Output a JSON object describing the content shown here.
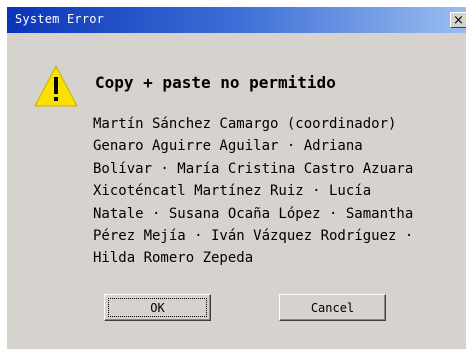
{
  "dialog": {
    "title": "System Error",
    "close_label": "×",
    "icon": "warning-icon",
    "heading": "Copy + paste no permitido",
    "message": "Martín Sánchez Camargo (coordinador)\nGenaro Aguirre Aguilar · Adriana\nBolívar · María Cristina Castro Azuara\nXicoténcatl Martínez Ruiz · Lucía\nNatale · Susana Ocaña López · Samantha\nPérez Mejía · Iván Vázquez Rodríguez ·\nHilda Romero Zepeda",
    "ok_label": "OK",
    "cancel_label": "Cancel"
  },
  "colors": {
    "titlebar_start": "#0a34b8",
    "titlebar_end": "#9bbdf0",
    "window_bg": "#d6d3ce",
    "warning_yellow": "#f8e000"
  }
}
